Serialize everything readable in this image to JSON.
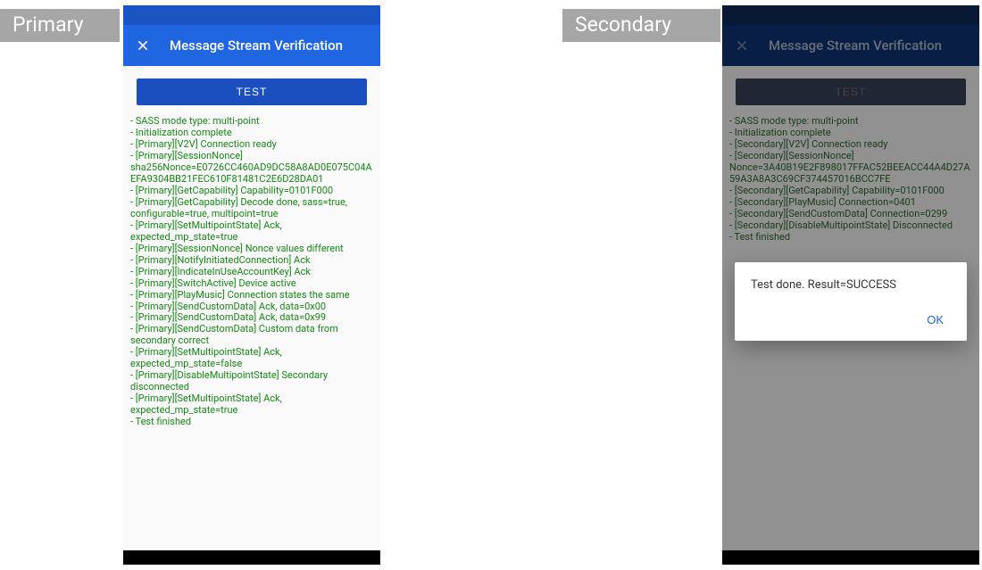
{
  "tags": {
    "primary": "Primary",
    "secondary": "Secondary"
  },
  "appbar": {
    "title": "Message Stream Verification",
    "test_button": "TEST"
  },
  "dialog": {
    "message": "Test done. Result=SUCCESS",
    "ok": "OK"
  },
  "primary_log": [
    " - SASS mode type: multi-point",
    " - Initialization complete",
    " - [Primary][V2V] Connection ready",
    " - [Primary][SessionNonce] sha256Nonce=E0726CC460AD9DC58A8AD0E075C04AEFA9304BB21FEC610F81481C2E6D28DA01",
    " - [Primary][GetCapability] Capability=0101F000",
    " - [Primary][GetCapability] Decode done, sass=true, configurable=true, multipoint=true",
    " - [Primary][SetMultipointState] Ack, expected_mp_state=true",
    " - [Primary][SessionNonce] Nonce values different",
    " - [Primary][NotifyInitiatedConnection] Ack",
    " - [Primary][IndicateInUseAccountKey] Ack",
    " - [Primary][SwitchActive] Device active",
    " - [Primary][PlayMusic] Connection states the same",
    " - [Primary][SendCustomData] Ack, data=0x00",
    " - [Primary][SendCustomData] Ack, data=0x99",
    " - [Primary][SendCustomData] Custom data from secondary correct",
    " - [Primary][SetMultipointState] Ack, expected_mp_state=false",
    " - [Primary][DisableMultipointState] Secondary disconnected",
    " - [Primary][SetMultipointState] Ack, expected_mp_state=true",
    " - Test finished"
  ],
  "secondary_log": [
    " - SASS mode type: multi-point",
    " - Initialization complete",
    " - [Secondary][V2V] Connection ready",
    " - [Secondary][SessionNonce] Nonce=3A40B19E2F898017FFAC52BEEACC44A4D27A59A3A8A3C69CF374457016BCC7FE",
    " - [Secondary][GetCapability] Capability=0101F000",
    " - [Secondary][PlayMusic] Connection=0401",
    " - [Secondary][SendCustomData] Connection=0299",
    " - [Secondary][DisableMultipointState] Disconnected",
    " - Test finished"
  ]
}
